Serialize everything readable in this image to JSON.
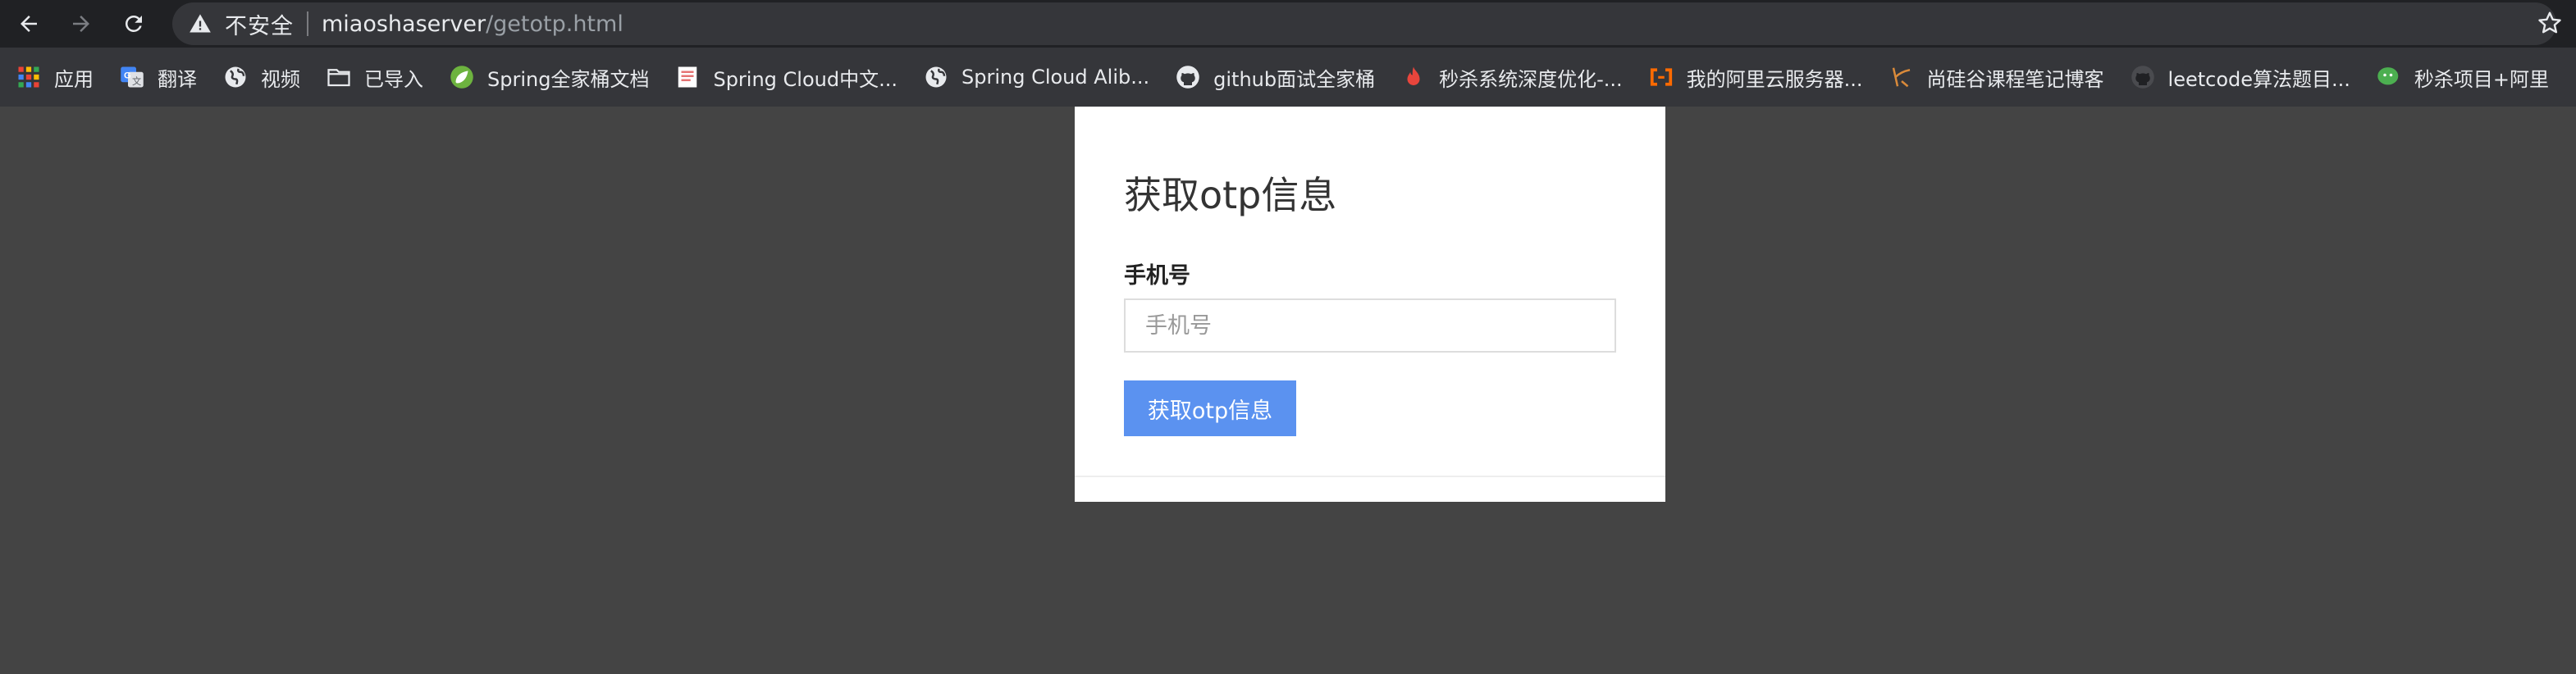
{
  "browser": {
    "security_label": "不安全",
    "url_host": "miaoshaserver",
    "url_path": "/getotp.html"
  },
  "bookmarks": [
    {
      "label": "应用",
      "icon": "apps-grid-icon"
    },
    {
      "label": "翻译",
      "icon": "google-translate-icon"
    },
    {
      "label": "视频",
      "icon": "globe-icon"
    },
    {
      "label": "已导入",
      "icon": "folder-icon"
    },
    {
      "label": "Spring全家桶文档",
      "icon": "spring-leaf-icon"
    },
    {
      "label": "Spring Cloud中文...",
      "icon": "document-icon"
    },
    {
      "label": "Spring Cloud Alib...",
      "icon": "globe-icon"
    },
    {
      "label": "github面试全家桶",
      "icon": "github-icon"
    },
    {
      "label": "秒杀系统深度优化-...",
      "icon": "flame-icon"
    },
    {
      "label": "我的阿里云服务器...",
      "icon": "aliyun-icon"
    },
    {
      "label": "尚硅谷课程笔记博客",
      "icon": "pen-icon"
    },
    {
      "label": "leetcode算法题目...",
      "icon": "github-icon"
    },
    {
      "label": "秒杀项目+阿里",
      "icon": "wechat-icon"
    }
  ],
  "form": {
    "title": "获取otp信息",
    "phone_label": "手机号",
    "phone_value": "",
    "phone_placeholder": "手机号",
    "submit_label": "获取otp信息"
  },
  "colors": {
    "page_background": "#444444",
    "card_background": "#ffffff",
    "button_primary": "#5b92f0",
    "toolbar": "#202124",
    "bookmark_bar": "#35363a"
  }
}
